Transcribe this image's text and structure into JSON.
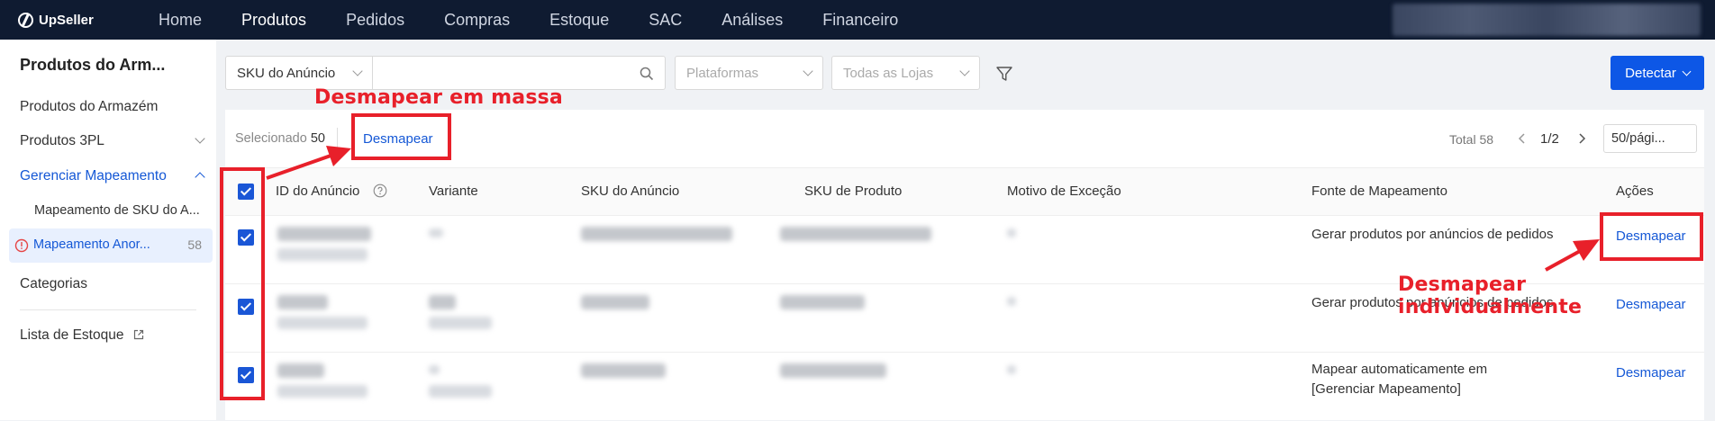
{
  "app": {
    "name": "UpSeller"
  },
  "nav": [
    {
      "label": "Home",
      "active": false
    },
    {
      "label": "Produtos",
      "active": true
    },
    {
      "label": "Pedidos",
      "active": false
    },
    {
      "label": "Compras",
      "active": false
    },
    {
      "label": "Estoque",
      "active": false
    },
    {
      "label": "SAC",
      "active": false
    },
    {
      "label": "Análises",
      "active": false
    },
    {
      "label": "Financeiro",
      "active": false
    }
  ],
  "sidebar": {
    "title": "Produtos do Arm...",
    "items": [
      {
        "label": "Produtos do Armazém"
      },
      {
        "label": "Produtos 3PL"
      },
      {
        "label": "Gerenciar Mapeamento"
      },
      {
        "label": "Mapeamento de SKU do A..."
      },
      {
        "label": "Mapeamento Anor...",
        "count": "58"
      },
      {
        "label": "Categorias"
      },
      {
        "label": "Lista de Estoque"
      }
    ]
  },
  "filters": {
    "field_select": "SKU do Anúncio",
    "search_value": "",
    "platforms_placeholder": "Plataformas",
    "stores_placeholder": "Todas as Lojas",
    "detect_label": "Detectar"
  },
  "toolbar": {
    "selected_label": "Selecionado",
    "selected_count": "50",
    "unmap_bulk_label": "Desmapear",
    "total_label": "Total 58",
    "page_indicator": "1/2",
    "page_size": "50/pági..."
  },
  "table": {
    "columns": [
      "ID do Anúncio",
      "Variante",
      "SKU do Anúncio",
      "SKU de Produto",
      "Motivo de Exceção",
      "Fonte de Mapeamento",
      "Ações"
    ],
    "rows": [
      {
        "source": "Gerar produtos por anúncios de pedidos",
        "action": "Desmapear"
      },
      {
        "source": "Gerar produtos por anúncios de pedidos",
        "action": "Desmapear"
      },
      {
        "source": "Mapear automaticamente em [Gerenciar Mapeamento]",
        "action": "Desmapear"
      }
    ]
  },
  "annotations": {
    "bulk": "Desmapear em massa",
    "individual": "Desmapear individualmente"
  },
  "colors": {
    "accent": "#0d57e6",
    "link": "#1558d6",
    "annotation_red": "#e8202a",
    "topbar": "#0f1b31"
  }
}
